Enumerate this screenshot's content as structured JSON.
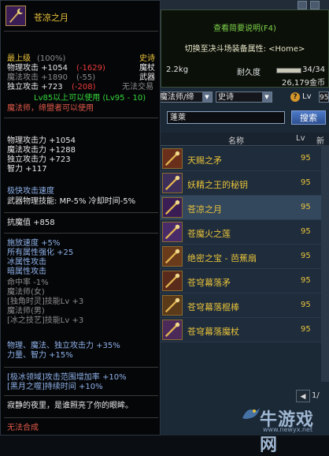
{
  "tooltip": {
    "item_name": "苍凉之月",
    "top_line": {
      "label": "最上级",
      "pct": "(100%)",
      "rarity": "史诗"
    },
    "stats_head": [
      {
        "label": "物理攻击 +1054",
        "diff": "(-1629)",
        "tag": "魔杖"
      },
      {
        "label": "魔法攻击 +1890",
        "diff": "(-55)",
        "tag": "武器"
      },
      {
        "label": "独立攻击 +723",
        "diff": "(-208)",
        "tag": "无法交易"
      }
    ],
    "level_req": "Lv85以上可以使用 (Lv95 - 10)",
    "class_req": "魔法师，缔盟者可以使用",
    "base_stats": [
      "物理攻击力 +1054",
      "魔法攻击力 +1288",
      "独立攻击力 +723",
      "智力 +117"
    ],
    "speed": "极快攻击速度",
    "weapon_skill": "武器物理技能: MP-5% 冷却时间-5%",
    "resist": "抗魔值 +858",
    "bonus_stats": [
      "施放速度 +5%",
      "所有属性强化 +25",
      "冰属性攻击",
      "暗属性攻击"
    ],
    "hit_rate": "命中率 -1%",
    "class_lines": [
      "魔法师(女)",
      "[独角时灵]技能Lv +3",
      "魔法师(男)",
      "[冰之技艺]技能Lv +3"
    ],
    "extra_stats": [
      "物理、魔法、独立攻击力 +35%",
      "力量、智力 +15%"
    ],
    "special": [
      "[极冰领域]攻击范围增加率 +10%",
      "[黑月之噬]持续时间 +10%"
    ],
    "flavor": "寂静的夜里，是谁照亮了你的眼眸。",
    "no_synth": "无法合成"
  },
  "panel": {
    "hotkey_hint": "查看简要说明(F4)",
    "switch_hint": "切换至决斗场装备属性: <Home>",
    "weight": "2.2kg",
    "durability_label": "耐久度",
    "durability_value": "34/34",
    "durability_fraction": 1.0,
    "gold": "26,179金币",
    "class_filter": "魔法师/缔",
    "rarity_filter": "史诗",
    "help_icon": "?",
    "lv_label": "Lv",
    "lv_value": "95",
    "search_value": "蓬萊",
    "search_button": "搜索",
    "col_name": "名称",
    "col_lv": "Lv",
    "col_new": "新",
    "items": [
      {
        "name": "天赐之矛",
        "lv": "95",
        "icon": "spear-icon",
        "selected": false
      },
      {
        "name": "妖精之王的秘钥",
        "lv": "95",
        "icon": "key-staff-icon",
        "selected": false
      },
      {
        "name": "苍凉之月",
        "lv": "95",
        "icon": "moon-staff-icon",
        "selected": true
      },
      {
        "name": "苍魔火之莲",
        "lv": "95",
        "icon": "lotus-staff-icon",
        "selected": false
      },
      {
        "name": "绝密之宝 - 芭蕉扇",
        "lv": "95",
        "icon": "fan-icon",
        "selected": false
      },
      {
        "name": "苍穹幕落矛",
        "lv": "95",
        "icon": "spear-icon",
        "selected": false
      },
      {
        "name": "苍穹幕落棍棒",
        "lv": "95",
        "icon": "rod-icon",
        "selected": false
      },
      {
        "name": "苍穹幕落魔杖",
        "lv": "95",
        "icon": "wand-icon",
        "selected": false
      }
    ],
    "page_prev": "◀",
    "page_num": "1/",
    "watermark_big": "牛游戏网",
    "watermark_small": "www.newyx.net"
  },
  "colors": {
    "gold": "#e8c23a",
    "red": "#ec3a3a",
    "green": "#34d83a",
    "blue": "#8fb2ea",
    "panel": "#1b2836"
  }
}
